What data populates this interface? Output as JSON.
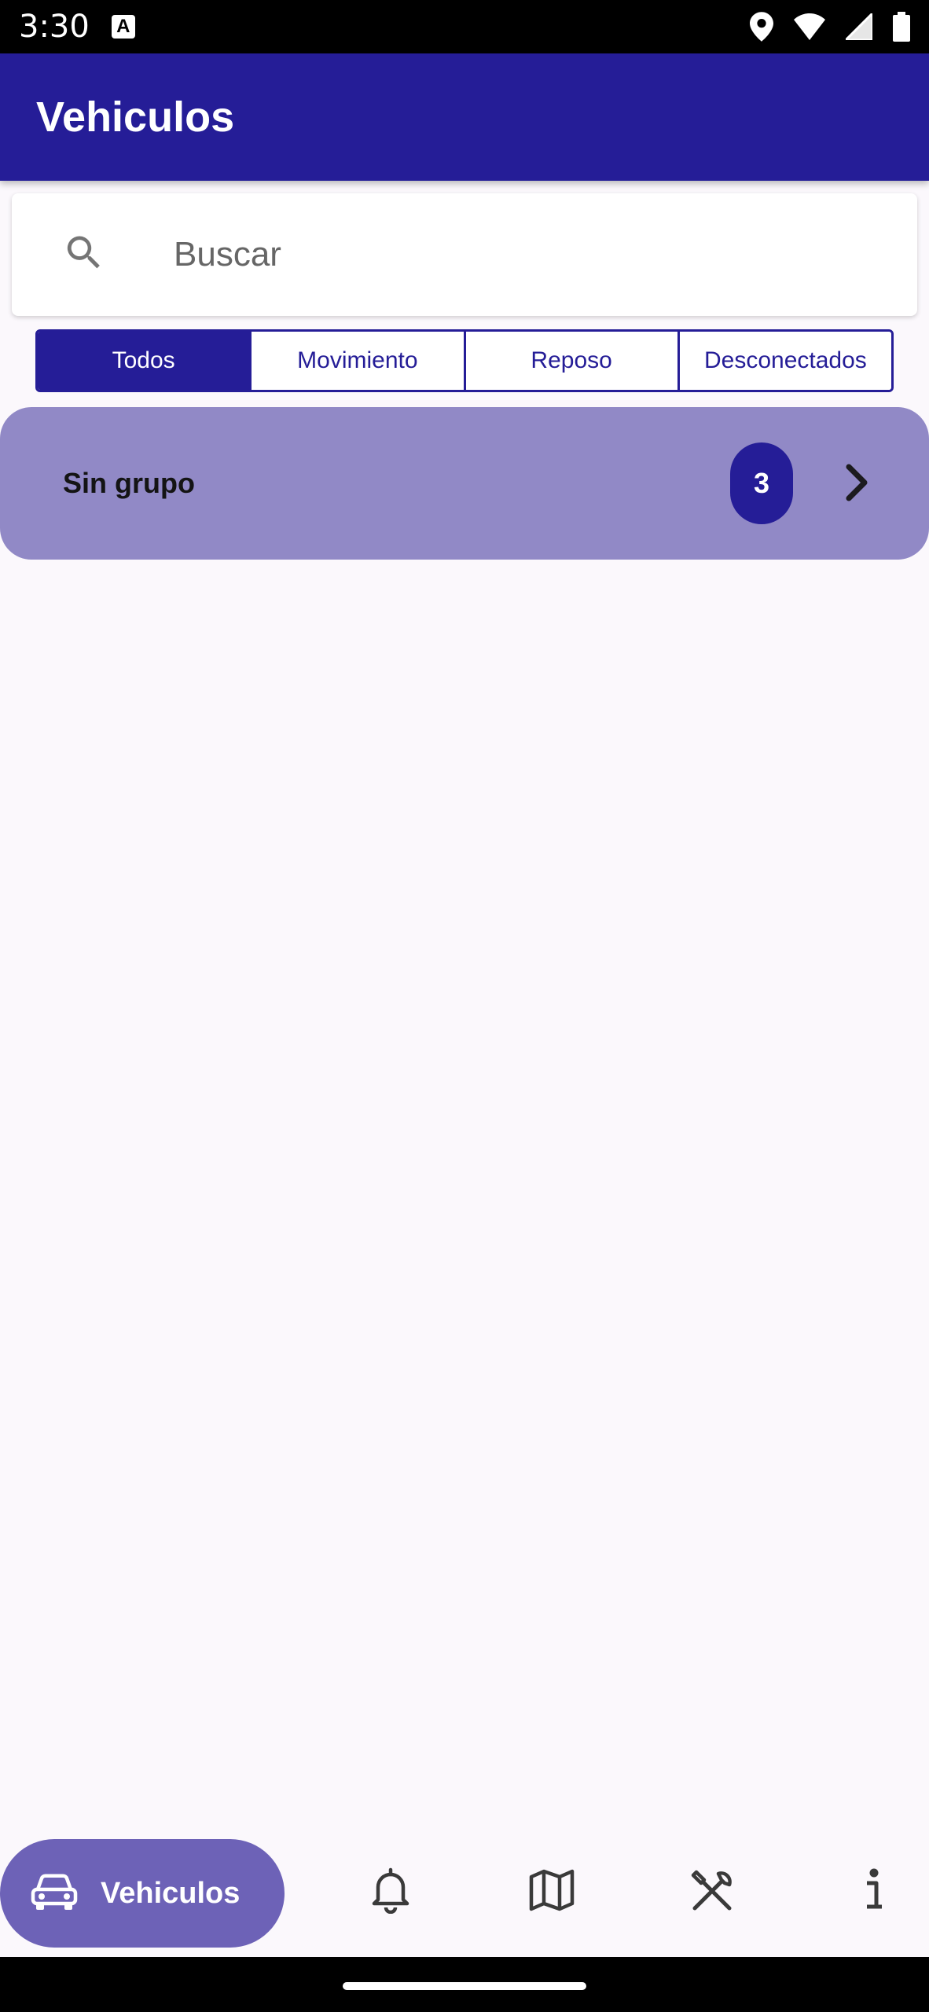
{
  "status_bar": {
    "time": "3:30",
    "icons": [
      "text-a-icon",
      "location-icon",
      "wifi-icon",
      "signal-icon",
      "battery-icon"
    ]
  },
  "app_bar": {
    "title": "Vehiculos",
    "color": "#251d97"
  },
  "search": {
    "placeholder": "Buscar",
    "value": ""
  },
  "filters": {
    "selected": "Todos",
    "options": [
      "Todos",
      "Movimiento",
      "Reposo",
      "Desconectados"
    ]
  },
  "groups": [
    {
      "name": "Sin grupo",
      "count": "3"
    }
  ],
  "bottom_nav": {
    "selected_label": "Vehiculos",
    "items": [
      "car-icon",
      "bell-icon",
      "map-icon",
      "tools-icon",
      "info-icon"
    ]
  },
  "colors": {
    "primary": "#251d97",
    "group_background": "#9189c6",
    "nav_selected": "#6d62b7",
    "page_background": "#fbf8fc"
  }
}
